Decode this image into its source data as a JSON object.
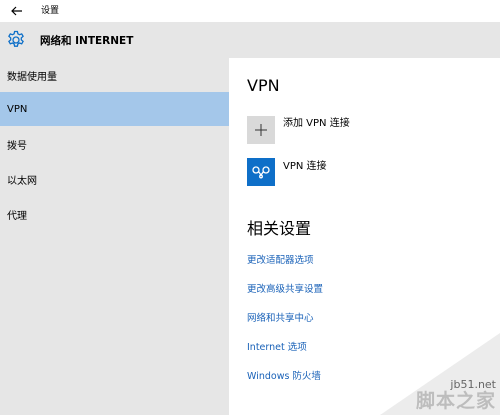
{
  "window": {
    "title": "设置"
  },
  "header": {
    "icon": "gear-icon",
    "title": "网络和 INTERNET"
  },
  "sidebar": {
    "items": [
      {
        "label": "数据使用量",
        "selected": false
      },
      {
        "label": "VPN",
        "selected": true
      },
      {
        "label": "拨号",
        "selected": false
      },
      {
        "label": "以太网",
        "selected": false
      },
      {
        "label": "代理",
        "selected": false
      }
    ],
    "selected_color": "#a4c7ea",
    "background": "#e6e6e6"
  },
  "main": {
    "vpn_title": "VPN",
    "add_connection": {
      "icon": "plus-icon",
      "label": "添加 VPN 连接"
    },
    "connection": {
      "icon": "vpn-connection-icon",
      "label": "VPN 连接"
    },
    "related_title": "相关设置",
    "links": [
      "更改适配器选项",
      "更改高级共享设置",
      "网络和共享中心",
      "Internet 选项",
      "Windows 防火墙"
    ],
    "link_color": "#1a62b8",
    "accent_color": "#0e6fc8"
  },
  "watermark": {
    "site": "jb51.net",
    "brand": "脚本之家"
  }
}
